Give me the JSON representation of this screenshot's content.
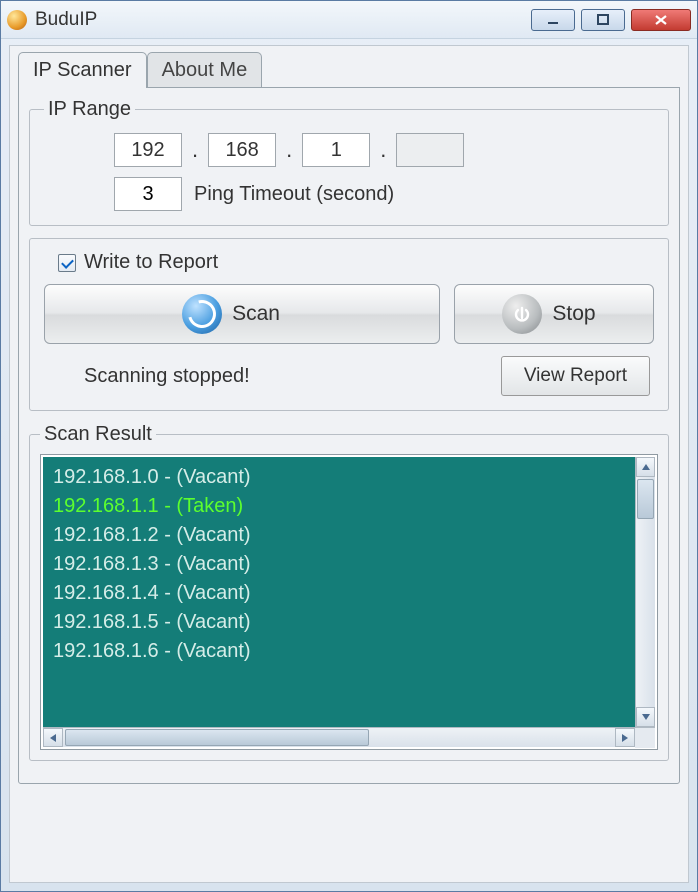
{
  "window": {
    "title": "BuduIP"
  },
  "tabs": {
    "scanner": "IP Scanner",
    "about": "About Me"
  },
  "ip_range": {
    "legend": "IP Range",
    "octet1": "192",
    "octet2": "168",
    "octet3": "1",
    "octet4": "",
    "timeout": "3",
    "timeout_label": "Ping Timeout (second)"
  },
  "controls": {
    "write_report": "Write to Report",
    "write_report_checked": true,
    "scan": "Scan",
    "stop": "Stop",
    "status": "Scanning stopped!",
    "view_report": "View Report"
  },
  "results": {
    "legend": "Scan Result",
    "rows": [
      {
        "text": "192.168.1.0 - (Vacant)",
        "status": "vacant"
      },
      {
        "text": "192.168.1.1 - (Taken)",
        "status": "taken"
      },
      {
        "text": "192.168.1.2 - (Vacant)",
        "status": "vacant"
      },
      {
        "text": "192.168.1.3 - (Vacant)",
        "status": "vacant"
      },
      {
        "text": "192.168.1.4 - (Vacant)",
        "status": "vacant"
      },
      {
        "text": "192.168.1.5 - (Vacant)",
        "status": "vacant"
      },
      {
        "text": "192.168.1.6 - (Vacant)",
        "status": "vacant"
      }
    ]
  }
}
